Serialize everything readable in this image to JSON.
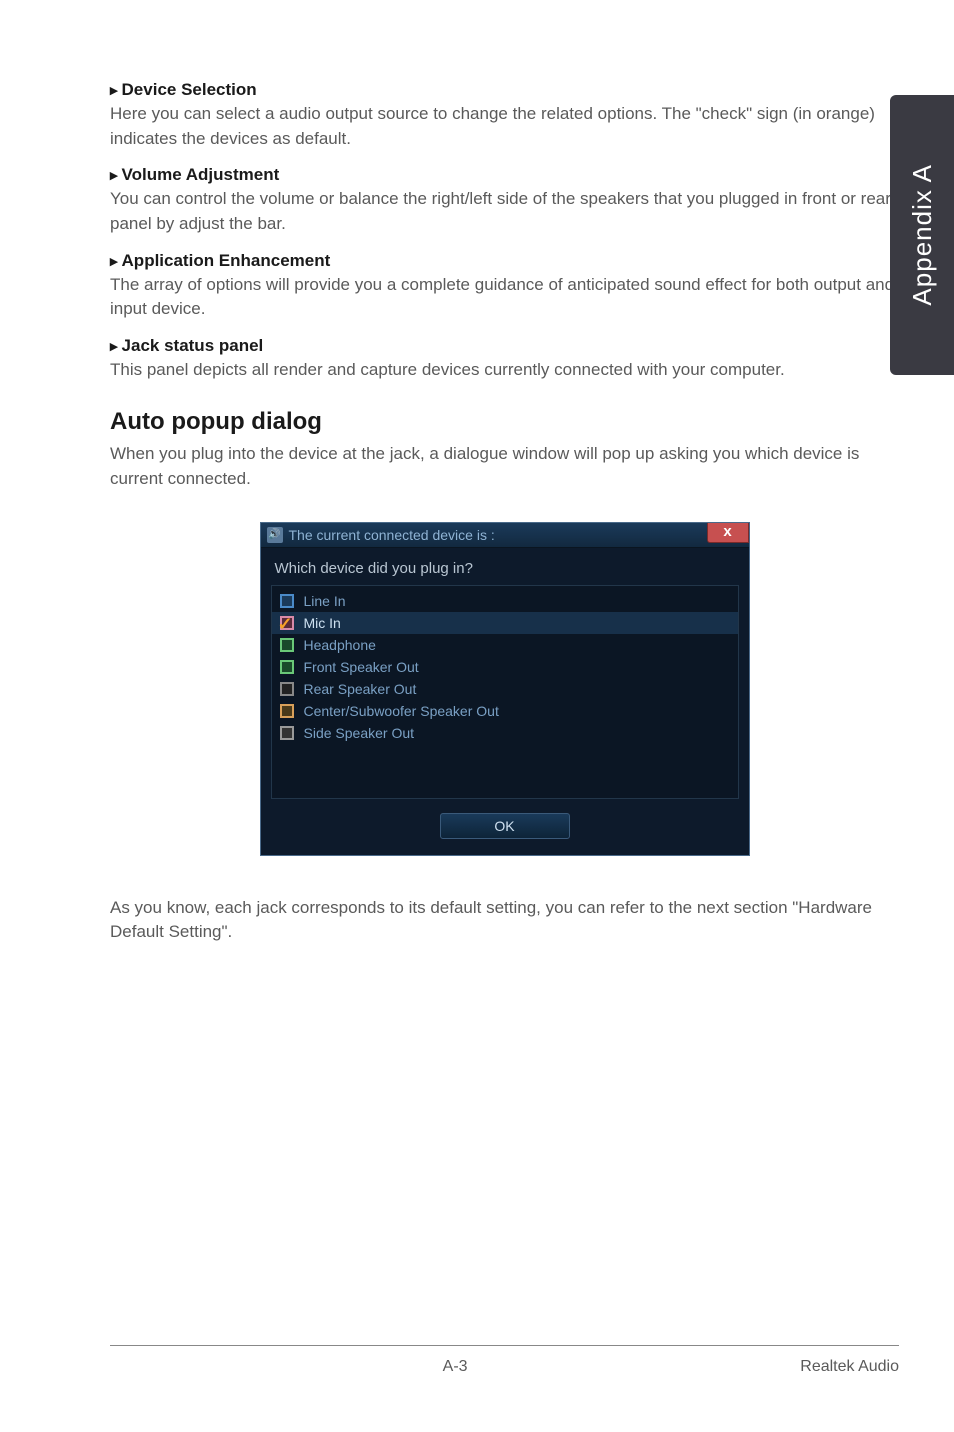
{
  "sidetab": {
    "label": "Appendix A"
  },
  "sections": {
    "device_selection": {
      "title": "Device Selection",
      "body": "Here you can select a audio output source to change the related options. The \"check\" sign (in orange) indicates the devices as default."
    },
    "volume_adjustment": {
      "title": "Volume Adjustment",
      "body": "You can control the volume or balance the right/left side of the speakers that you plugged in front or rear panel by adjust the bar."
    },
    "application_enhancement": {
      "title": "Application Enhancement",
      "body": "The array of options will provide you a complete guidance of anticipated sound effect for both output and input device."
    },
    "jack_status": {
      "title": "Jack status panel",
      "body": "This panel depicts all render and capture devices currently connected with your computer."
    }
  },
  "auto_popup": {
    "heading": "Auto popup dialog",
    "body": "When you plug into the device at the jack, a dialogue window will pop up asking you which device is current connected."
  },
  "dialog": {
    "title": "The current connected device is :",
    "question": "Which device did you plug in?",
    "devices": {
      "line_in": "Line In",
      "mic_in": "Mic In",
      "headphone": "Headphone",
      "front_speaker": "Front Speaker Out",
      "rear_speaker": "Rear Speaker Out",
      "center_sub": "Center/Subwoofer Speaker Out",
      "side_speaker": "Side Speaker Out"
    },
    "ok": "OK",
    "close": "x"
  },
  "closing_text": "As you know, each jack corresponds to its default setting, you can refer to the next section \"Hardware Default Setting\".",
  "footer": {
    "page": "A-3",
    "section": "Realtek Audio"
  }
}
